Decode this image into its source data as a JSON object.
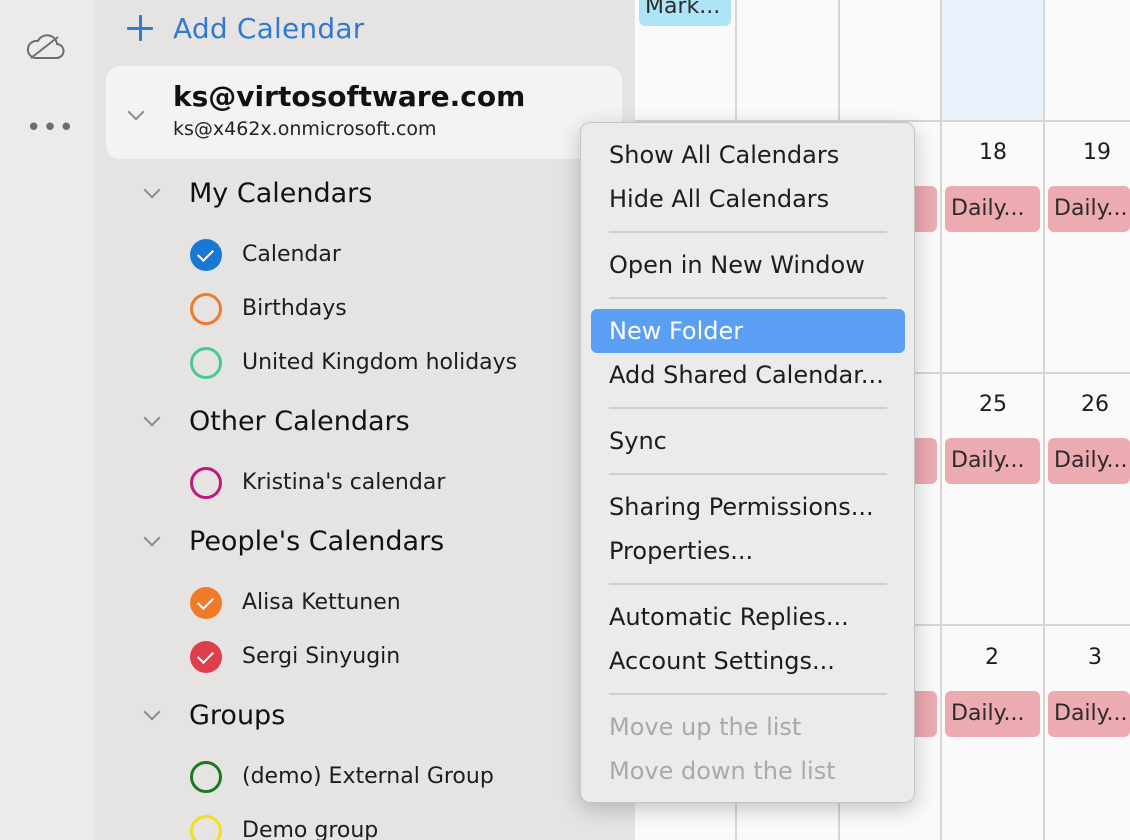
{
  "sidebar": {
    "add_calendar_label": "Add Calendar",
    "account": {
      "name": "ks@virtosoftware.com",
      "email": "ks@x462x.onmicrosoft.com"
    },
    "groups": [
      {
        "title": "My Calendars",
        "items": [
          {
            "label": "Calendar",
            "color": "#1a78d4",
            "checked": true
          },
          {
            "label": "Birthdays",
            "color": "#f07a28",
            "checked": false
          },
          {
            "label": "United Kingdom holidays",
            "color": "#48c991",
            "checked": false
          }
        ]
      },
      {
        "title": "Other Calendars",
        "items": [
          {
            "label": "Kristina's calendar",
            "color": "#c0197b",
            "checked": false
          }
        ]
      },
      {
        "title": "People's Calendars",
        "items": [
          {
            "label": "Alisa Kettunen",
            "color": "#f07a28",
            "checked": true
          },
          {
            "label": "Sergi Sinyugin",
            "color": "#de3f4a",
            "checked": true
          }
        ]
      },
      {
        "title": "Groups",
        "items": [
          {
            "label": "(demo) External Group",
            "color": "#1b7a1f",
            "checked": false
          },
          {
            "label": "Demo group",
            "color": "#f2de1c",
            "checked": false
          }
        ]
      }
    ]
  },
  "calendar": {
    "top_event": "Mark...",
    "rows": [
      {
        "days": [
          "18",
          "19"
        ],
        "events": [
          ".",
          "Daily...",
          "Daily..."
        ]
      },
      {
        "days": [
          "25",
          "26"
        ],
        "events": [
          ".",
          "Daily...",
          "Daily..."
        ]
      },
      {
        "days": [
          "2",
          "3"
        ],
        "events": [
          ".",
          "Daily...",
          "Daily..."
        ]
      }
    ]
  },
  "context_menu": {
    "items": [
      {
        "label": "Show All Calendars",
        "enabled": true
      },
      {
        "label": "Hide All Calendars",
        "enabled": true
      },
      {
        "label": "Open in New Window",
        "enabled": true
      },
      {
        "label": "New Folder",
        "enabled": true,
        "highlighted": true
      },
      {
        "label": "Add Shared Calendar...",
        "enabled": true
      },
      {
        "label": "Sync",
        "enabled": true
      },
      {
        "label": "Sharing Permissions...",
        "enabled": true
      },
      {
        "label": "Properties...",
        "enabled": true
      },
      {
        "label": "Automatic Replies...",
        "enabled": true
      },
      {
        "label": "Account Settings...",
        "enabled": true
      },
      {
        "label": "Move up the list",
        "enabled": false
      },
      {
        "label": "Move down the list",
        "enabled": false
      }
    ]
  },
  "icons": {
    "rail_top": "cloud-icon",
    "rail_more": "more-icon",
    "add": "plus-icon"
  }
}
